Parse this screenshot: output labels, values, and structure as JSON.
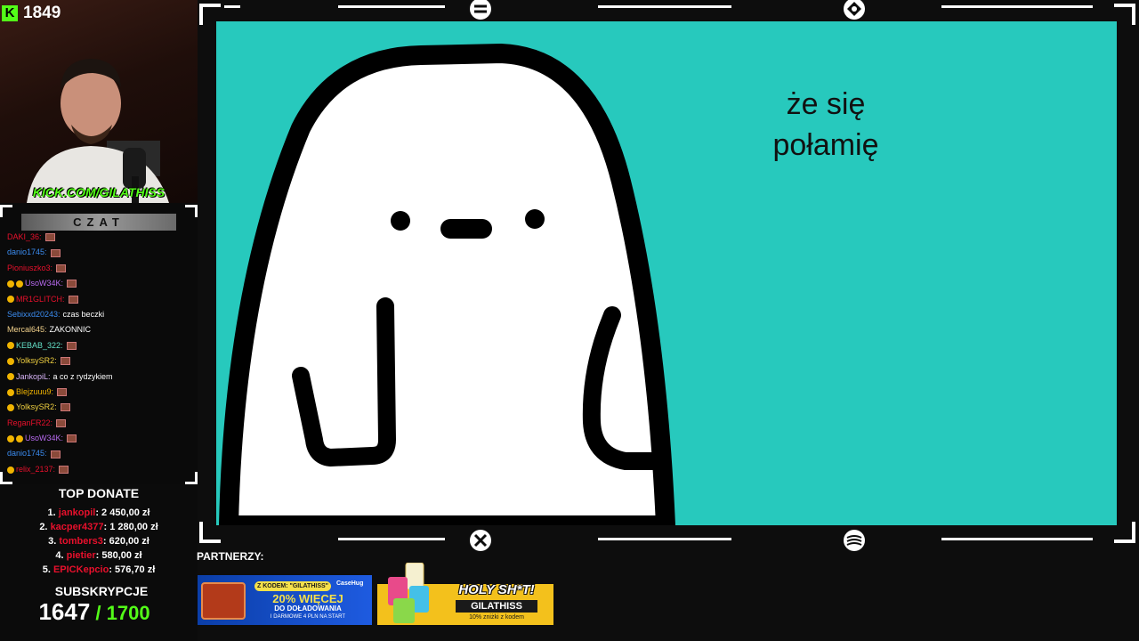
{
  "overlay": {
    "viewer_count": "1849",
    "kick_logo": "K",
    "kick_url": "KICK.COM/GILATHISS"
  },
  "chat": {
    "header": "CZAT",
    "messages": [
      {
        "user": "DAKI_36:",
        "color": "#e8102c",
        "badges": 0,
        "text": "",
        "emote": true
      },
      {
        "user": "danio1745:",
        "color": "#3b8cf0",
        "badges": 0,
        "text": "",
        "emote": true
      },
      {
        "user": "Pioniuszko3:",
        "color": "#e8102c",
        "badges": 0,
        "text": "",
        "emote": true
      },
      {
        "user": "UsoW34K:",
        "color": "#b86af0",
        "badges": 2,
        "text": "",
        "emote": true
      },
      {
        "user": "MR1GLITCH:",
        "color": "#e8102c",
        "badges": 1,
        "text": "",
        "emote": true
      },
      {
        "user": "Sebixxd20243:",
        "color": "#3b8cf0",
        "badges": 0,
        "text": "czas beczki",
        "emote": false
      },
      {
        "user": "Mercal645:",
        "color": "#f3d28c",
        "badges": 0,
        "text": "ZAKONNIC",
        "emote": false
      },
      {
        "user": "KEBAB_322:",
        "color": "#64e0c8",
        "badges": 1,
        "text": "",
        "emote": true
      },
      {
        "user": "YolksySR2:",
        "color": "#f0d040",
        "badges": 1,
        "text": "",
        "emote": true
      },
      {
        "user": "JankopiL:",
        "color": "#d8b4f8",
        "badges": 1,
        "text": "a co z rydzykiem",
        "emote": false
      },
      {
        "user": "Blejzuuu9:",
        "color": "#f0b400",
        "badges": 1,
        "text": "",
        "emote": true
      },
      {
        "user": "YolksySR2:",
        "color": "#f0d040",
        "badges": 1,
        "text": "",
        "emote": true
      },
      {
        "user": "ReganFR22:",
        "color": "#e8102c",
        "badges": 0,
        "text": "",
        "emote": true
      },
      {
        "user": "UsoW34K:",
        "color": "#b86af0",
        "badges": 2,
        "text": "",
        "emote": true
      },
      {
        "user": "danio1745:",
        "color": "#3b8cf0",
        "badges": 0,
        "text": "",
        "emote": true
      },
      {
        "user": "relix_2137:",
        "color": "#e8102c",
        "badges": 1,
        "text": "",
        "emote": true
      }
    ]
  },
  "top_donate": {
    "title": "TOP DONATE",
    "entries": [
      {
        "rank": "1.",
        "name": "jankopil",
        "amount": ": 2 450,00 zł"
      },
      {
        "rank": "2.",
        "name": "kacper4377",
        "amount": ": 1 280,00 zł"
      },
      {
        "rank": "3.",
        "name": "tombers3",
        "amount": ": 620,00 zł"
      },
      {
        "rank": "4.",
        "name": "pietier",
        "amount": ": 580,00 zł"
      },
      {
        "rank": "5.",
        "name": "EPICKepcio",
        "amount": ": 576,70 zł"
      }
    ]
  },
  "subscriptions": {
    "title": "SUBSKRYPCJE",
    "current": "1647",
    "goal": " / 1700"
  },
  "scene": {
    "caption_line1": "że się",
    "caption_line2": "połamię",
    "background_color": "#27c9bd"
  },
  "partners": {
    "label": "PARTNERZY:",
    "ad1": {
      "code": "Z KODEM: \"GILATHISS\"",
      "brand": "CaseHug",
      "headline": "20% WIĘCEJ",
      "sub": "DO DOŁADOWANIA",
      "fine": "I DARMOWE 4 PLN NA START"
    },
    "ad2": {
      "title": "HOLY SH*T!",
      "code": "GILATHISS",
      "note": "10% zniżki z kodem"
    }
  }
}
